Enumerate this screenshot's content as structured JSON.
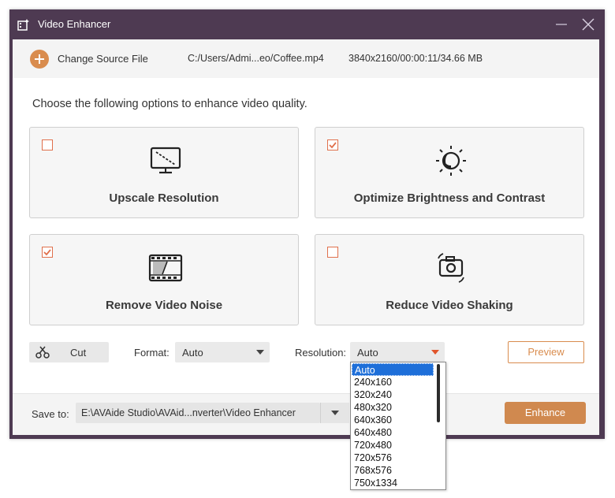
{
  "window": {
    "title": "Video Enhancer"
  },
  "source": {
    "change_label": "Change Source File",
    "path": "C:/Users/Admi...eo/Coffee.mp4",
    "meta": "3840x2160/00:00:11/34.66 MB"
  },
  "instruction": "Choose the following options to enhance video quality.",
  "options": [
    {
      "label": "Upscale Resolution",
      "checked": false,
      "icon": "monitor-upscale-icon"
    },
    {
      "label": "Optimize Brightness and Contrast",
      "checked": true,
      "icon": "brightness-icon"
    },
    {
      "label": "Remove Video Noise",
      "checked": true,
      "icon": "film-noise-icon"
    },
    {
      "label": "Reduce Video Shaking",
      "checked": false,
      "icon": "camera-stabilize-icon"
    }
  ],
  "toolbar": {
    "cut_label": "Cut",
    "format_label": "Format:",
    "format_value": "Auto",
    "resolution_label": "Resolution:",
    "resolution_value": "Auto",
    "preview_label": "Preview"
  },
  "save": {
    "label": "Save to:",
    "path": "E:\\AVAide Studio\\AVAid...nverter\\Video Enhancer",
    "enhance_label": "Enhance"
  },
  "resolution_options": [
    "Auto",
    "240x160",
    "320x240",
    "480x320",
    "640x360",
    "640x480",
    "720x480",
    "720x576",
    "768x576",
    "750x1334"
  ],
  "resolution_selected_index": 0,
  "colors": {
    "accent": "#d0894f",
    "titlebar": "#4e3a52",
    "checkbox": "#e0704c",
    "selection": "#1e6fd9"
  }
}
